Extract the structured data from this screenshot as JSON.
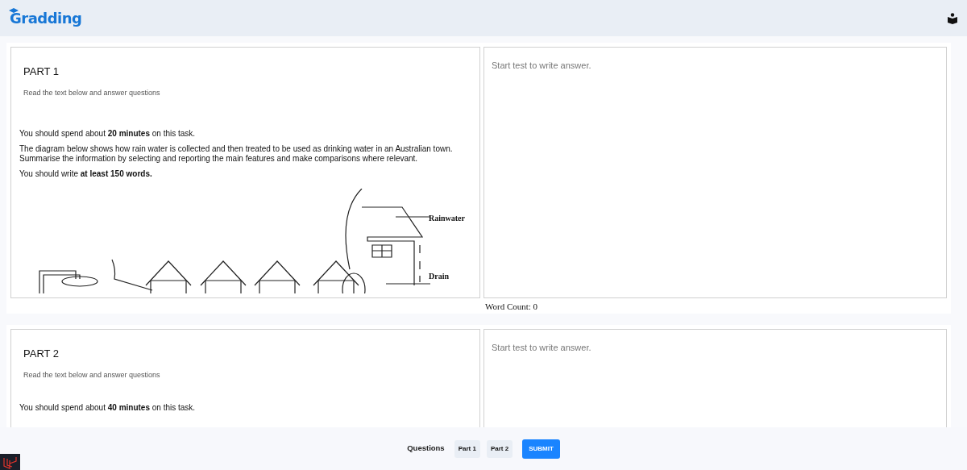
{
  "header": {
    "logo": "Gradding"
  },
  "parts": [
    {
      "title": "PART 1",
      "subtitle": "Read the text below and answer questions",
      "paragraphs": [
        "You should spend about **20 minutes** on this task.",
        "The diagram below shows how rain water is collected and then treated to be used as drinking water in an Australian town. Summarise the information by selecting and reporting the main features and make comparisons where relevant.",
        "You should write **at least 150 words.**"
      ],
      "diagram": {
        "labels": [
          "Rainwater",
          "Drain"
        ]
      },
      "answer": {
        "placeholder": "Start test to write answer."
      },
      "word_count": "Word Count: 0"
    },
    {
      "title": "PART 2",
      "subtitle": "Read the text below and answer questions",
      "paragraphs": [
        "You should spend about **40 minutes** on this task."
      ],
      "answer": {
        "placeholder": "Start test to write answer."
      }
    }
  ],
  "footer": {
    "label": "Questions",
    "parts": [
      {
        "label": "Part 1"
      },
      {
        "label": "Part 2"
      }
    ],
    "submit": "SUBMIT"
  }
}
